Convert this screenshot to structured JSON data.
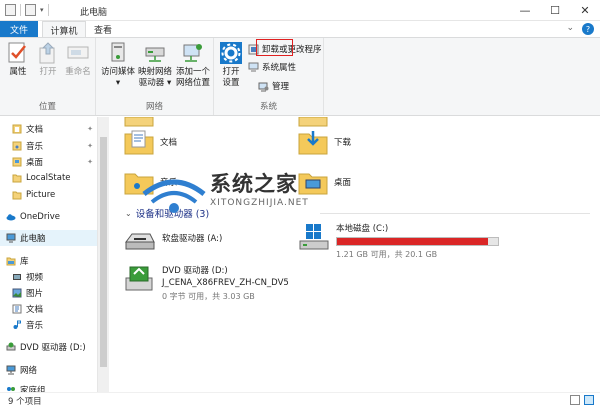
{
  "window": {
    "title": "此电脑",
    "minimize": "—",
    "maximize": "☐",
    "close": "✕"
  },
  "tabs": {
    "file": "文件",
    "computer": "计算机",
    "view": "查看",
    "collapse": "⌄",
    "help": "?"
  },
  "ribbon": {
    "location": {
      "label": "位置",
      "properties": "属性",
      "open": "打开",
      "rename": "重命名"
    },
    "network": {
      "label": "网络",
      "access_media": [
        "访问媒体",
        "▾"
      ],
      "map_drive": [
        "映射网络",
        "驱动器 ▾"
      ],
      "add_location": [
        "添加一个",
        "网络位置"
      ]
    },
    "system": {
      "label": "系统",
      "open_settings": [
        "打开",
        "设置"
      ],
      "uninstall": "卸载或更改程序",
      "system_properties": "系统属性",
      "manage": "管理"
    }
  },
  "sidebar": {
    "items": [
      {
        "label": "文档",
        "pinned": true
      },
      {
        "label": "音乐",
        "pinned": true
      },
      {
        "label": "桌面",
        "pinned": true
      },
      {
        "label": "LocalState",
        "pinned": false
      },
      {
        "label": "Picture",
        "pinned": false
      },
      {
        "label": "OneDrive"
      },
      {
        "label": "此电脑"
      },
      {
        "label": "库"
      },
      {
        "label": "视频"
      },
      {
        "label": "图片"
      },
      {
        "label": "文档"
      },
      {
        "label": "音乐"
      },
      {
        "label": "DVD 驱动器 (D:)"
      },
      {
        "label": "网络"
      },
      {
        "label": "家庭组"
      }
    ],
    "pin_glyph": "✦"
  },
  "content": {
    "folders": [
      {
        "label": ""
      },
      {
        "label": ""
      },
      {
        "label": "文档"
      },
      {
        "label": "下载"
      },
      {
        "label": "音乐"
      },
      {
        "label": "桌面"
      }
    ],
    "section_title": "设备和驱动器 (3)",
    "drives": {
      "floppy": {
        "name": "软盘驱动器 (A:)"
      },
      "local": {
        "name": "本地磁盘 (C:)",
        "usage": "1.21 GB 可用，共 20.1 GB",
        "used_fraction": 0.94
      },
      "dvd": {
        "name": "DVD 驱动器 (D:)",
        "volume": "J_CENA_X86FREV_ZH-CN_DV5",
        "usage": "0 字节 可用，共 3.03 GB"
      }
    }
  },
  "watermark": {
    "main": "系统之家",
    "sub": "XITONGZHIJIA.NET"
  },
  "status": {
    "items": "9 个项目"
  },
  "colors": {
    "accent": "#1979ca",
    "drive_bar": "#da2626",
    "highlight": "#e02020"
  }
}
